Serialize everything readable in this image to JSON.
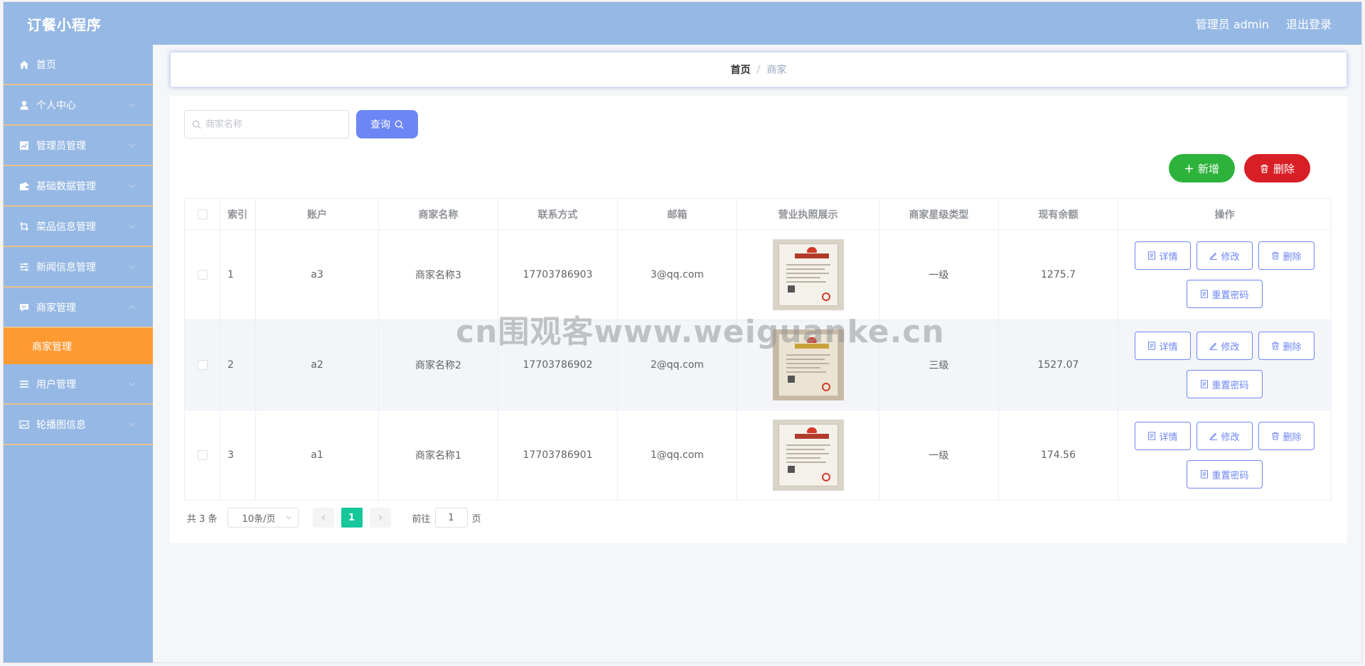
{
  "header": {
    "app_title": "订餐小程序",
    "user_label": "管理员 admin",
    "logout_label": "退出登录"
  },
  "sidebar": {
    "items": [
      {
        "label": "首页",
        "icon": "home-icon"
      },
      {
        "label": "个人中心",
        "icon": "user-icon"
      },
      {
        "label": "管理员管理",
        "icon": "chart-icon"
      },
      {
        "label": "基础数据管理",
        "icon": "wallet-icon"
      },
      {
        "label": "菜品信息管理",
        "icon": "crop-icon"
      },
      {
        "label": "新闻信息管理",
        "icon": "sliders-icon"
      },
      {
        "label": "商家管理",
        "icon": "message-icon"
      },
      {
        "label": "用户管理",
        "icon": "list-icon"
      },
      {
        "label": "轮播图信息",
        "icon": "picture-icon"
      }
    ],
    "active_sub": "商家管理"
  },
  "breadcrumb": {
    "home": "首页",
    "sep": "/",
    "current": "商家"
  },
  "search": {
    "placeholder": "商家名称",
    "button_label": "查询"
  },
  "actions": {
    "add_label": "新增",
    "delete_label": "删除"
  },
  "table": {
    "headers": [
      "索引",
      "账户",
      "商家名称",
      "联系方式",
      "邮箱",
      "营业执照展示",
      "商家星级类型",
      "现有余额",
      "操作"
    ],
    "rows": [
      {
        "index": "1",
        "account": "a3",
        "name": "商家名称3",
        "phone": "17703786903",
        "email": "3@qq.com",
        "level": "一级",
        "balance": "1275.7"
      },
      {
        "index": "2",
        "account": "a2",
        "name": "商家名称2",
        "phone": "17703786902",
        "email": "2@qq.com",
        "level": "三级",
        "balance": "1527.07"
      },
      {
        "index": "3",
        "account": "a1",
        "name": "商家名称1",
        "phone": "17703786901",
        "email": "1@qq.com",
        "level": "一级",
        "balance": "174.56"
      }
    ],
    "op_labels": {
      "detail": "详情",
      "edit": "修改",
      "delete": "删除",
      "reset": "重置密码"
    }
  },
  "pagination": {
    "total": "共 3 条",
    "page_size": "10条/页",
    "current_page": "1",
    "goto_prefix": "前往",
    "goto_value": "1",
    "goto_suffix": "页"
  },
  "watermark": "cn围观客www.weiguanke.cn",
  "colors": {
    "header_bg": "#96b8e4",
    "sidebar_active": "#ff9a33",
    "primary": "#6d86f5",
    "success": "#2db33b",
    "danger": "#d81f25",
    "page_active": "#16c79a"
  }
}
